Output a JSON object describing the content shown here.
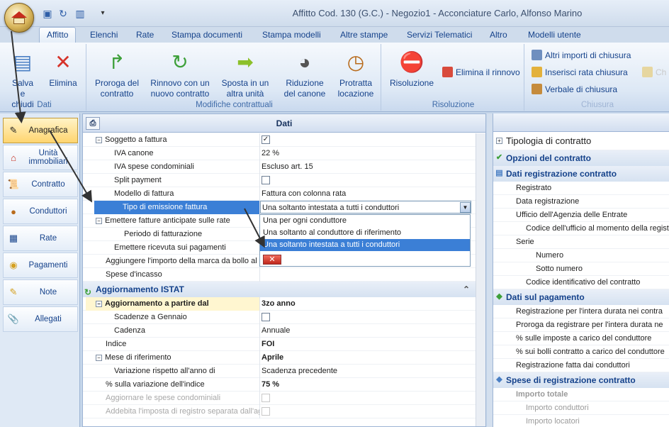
{
  "window": {
    "title": "Affitto Cod. 130 (G.C.) - Negozio1 - Acconciature Carlo, Alfonso Marino"
  },
  "tabs": [
    "Affitto",
    "Elenchi",
    "Rate",
    "Stampa documenti",
    "Stampa modelli",
    "Altre stampe",
    "Servizi Telematici",
    "Altro",
    "Modelli utente"
  ],
  "ribbon": {
    "groups": [
      "Dati",
      "Modifiche contrattuali",
      "Risoluzione",
      "Chiusura"
    ],
    "salva": "Salva e chiudi",
    "elimina": "Elimina",
    "proroga": "Proroga del contratto",
    "rinnovo": "Rinnovo con un nuovo contratto",
    "sposta": "Sposta in un altra unità",
    "riduzione": "Riduzione del canone",
    "protratta": "Protratta locazione",
    "risoluzione": "Risoluzione",
    "elimina_rinnovo": "Elimina il rinnovo",
    "altri_importi": "Altri importi di chiusura",
    "inserisci_rata": "Inserisci rata chiusura",
    "verbale": "Verbale di chiusura",
    "ch_cut": "Ch"
  },
  "nav": [
    "Anagrafica",
    "Unità immobiliari",
    "Contratto",
    "Conduttori",
    "Rate",
    "Pagamenti",
    "Note",
    "Allegati"
  ],
  "panel": {
    "title": "Dati"
  },
  "grid": {
    "rows": [
      {
        "label": "Soggetto a fattura",
        "value": "",
        "check": "checked"
      },
      {
        "label": "IVA canone",
        "value": "22 %"
      },
      {
        "label": "IVA spese condominiali",
        "value": "Escluso art. 15"
      },
      {
        "label": "Split payment",
        "value": "",
        "check": "unchecked"
      },
      {
        "label": "Modello di fattura",
        "value": "Fattura con colonna rata"
      },
      {
        "label": "Tipo di emissione fattura",
        "value": "Una soltanto intestata a tutti i conduttori"
      },
      {
        "label": "Emettere fatture anticipate sulle rate",
        "value": ""
      },
      {
        "label": "Periodo di fatturazione",
        "value": ""
      },
      {
        "label": "Emettere ricevuta sui pagamenti",
        "value": ""
      },
      {
        "label": "Aggiungere l'importo della marca da bollo al c",
        "value": ""
      },
      {
        "label": "Spese d'incasso",
        "value": ""
      }
    ],
    "istat_category": "Aggiornamento ISTAT",
    "istat_rows": [
      {
        "label": "Aggiornamento a partire dal",
        "value": "3zo anno"
      },
      {
        "label": "Scadenze a Gennaio",
        "value": ""
      },
      {
        "label": "Cadenza",
        "value": "Annuale"
      },
      {
        "label": "Indice",
        "value": "FOI"
      },
      {
        "label": "Mese di riferimento",
        "value": "Aprile"
      },
      {
        "label": "Variazione rispetto all'anno di",
        "value": "Scadenza precedente"
      },
      {
        "label": "% sulla variazione dell'indice",
        "value": "75 %"
      },
      {
        "label": "Aggiornare le spese condominiali",
        "value": ""
      },
      {
        "label": "Addebita l'imposta di registro separata dall'ag",
        "value": ""
      }
    ]
  },
  "dropdown": {
    "options": [
      "Una per ogni conduttore",
      "Una soltanto al conduttore di riferimento",
      "Una soltanto intestata a tutti i conduttori"
    ],
    "selected_index": 2
  },
  "right": {
    "title": "Tipologia di contratto",
    "items": [
      {
        "type": "cat",
        "text": "Opzioni del contratto"
      },
      {
        "type": "cat",
        "text": "Dati registrazione contratto"
      },
      {
        "type": "row",
        "text": "Registrato",
        "indent": 0
      },
      {
        "type": "row",
        "text": "Data registrazione",
        "indent": 0
      },
      {
        "type": "row",
        "text": "Ufficio dell'Agenzia delle Entrate",
        "indent": 0
      },
      {
        "type": "row",
        "text": "Codice dell'ufficio al momento della registr",
        "indent": 1
      },
      {
        "type": "row",
        "text": "Serie",
        "indent": 0
      },
      {
        "type": "row",
        "text": "Numero",
        "indent": 2
      },
      {
        "type": "row",
        "text": "Sotto numero",
        "indent": 2
      },
      {
        "type": "row",
        "text": "Codice identificativo del contratto",
        "indent": 1
      },
      {
        "type": "cat",
        "text": "Dati sul pagamento"
      },
      {
        "type": "row",
        "text": "Registrazione per l'intera durata nei contra",
        "indent": 0
      },
      {
        "type": "row",
        "text": "Proroga da registrare per l'intera durata ne",
        "indent": 0
      },
      {
        "type": "row",
        "text": "% sulle imposte a carico del conduttore",
        "indent": 0
      },
      {
        "type": "row",
        "text": "% sui bolli contratto a carico del conduttore",
        "indent": 0
      },
      {
        "type": "row",
        "text": "Registrazione fatta dai conduttori",
        "indent": 0
      },
      {
        "type": "cat",
        "text": "Spese di registrazione contratto"
      },
      {
        "type": "row",
        "text": "Importo totale",
        "indent": 0
      },
      {
        "type": "row",
        "text": "Importo conduttori",
        "indent": 1
      },
      {
        "type": "row",
        "text": "Importo locatori",
        "indent": 1
      }
    ]
  }
}
